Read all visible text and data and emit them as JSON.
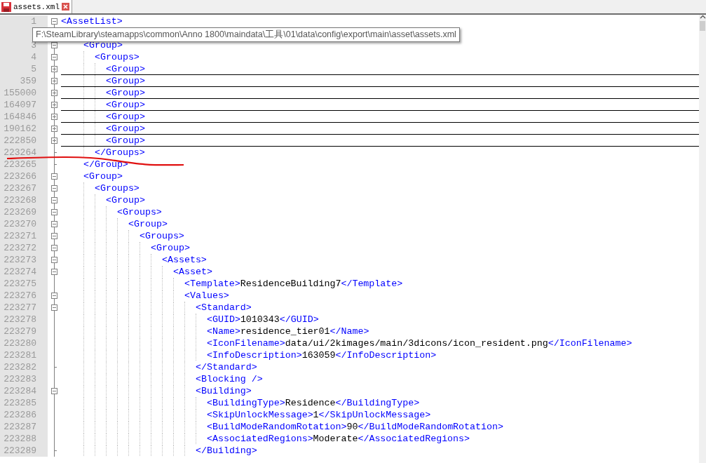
{
  "tab": {
    "title": "assets.xml",
    "selected": true
  },
  "tooltip": "F:\\SteamLibrary\\steamapps\\common\\Anno 1800\\maindata\\工具\\01\\data\\config\\export\\main\\asset\\assets.xml",
  "lines": [
    {
      "line": "1",
      "open": "<AssetList>",
      "expanded": true,
      "children": [
        {
          "expanded": true,
          "children": [
            {
              "line": "3",
              "open": "<Group>",
              "expanded": true,
              "end_line": "223265",
              "end_tag": "</Group>",
              "children": [
                {
                  "line": "4",
                  "open": "<Groups>",
                  "expanded": true,
                  "end_line": "223264",
                  "end_tag": "</Groups>",
                  "children": [
                    {
                      "line": "5",
                      "open": "<Group>",
                      "expanded": false
                    },
                    {
                      "line": "359",
                      "open": "<Group>",
                      "expanded": false
                    },
                    {
                      "line": "155000",
                      "open": "<Group>",
                      "expanded": false
                    },
                    {
                      "line": "164097",
                      "open": "<Group>",
                      "expanded": false
                    },
                    {
                      "line": "164846",
                      "open": "<Group>",
                      "expanded": false
                    },
                    {
                      "line": "190162",
                      "open": "<Group>",
                      "expanded": false
                    },
                    {
                      "line": "222850",
                      "open": "<Group>",
                      "expanded": false
                    }
                  ]
                }
              ]
            },
            {
              "line": "223266",
              "open": "<Group>",
              "expanded": true,
              "children": [
                {
                  "line": "223267",
                  "open": "<Groups>",
                  "expanded": true,
                  "children": [
                    {
                      "line": "223268",
                      "open": "<Group>",
                      "expanded": true,
                      "children": [
                        {
                          "line": "223269",
                          "open": "<Groups>",
                          "expanded": true,
                          "children": [
                            {
                              "line": "223270",
                              "open": "<Group>",
                              "expanded": true,
                              "children": [
                                {
                                  "line": "223271",
                                  "open": "<Groups>",
                                  "expanded": true,
                                  "children": [
                                    {
                                      "line": "223272",
                                      "open": "<Group>",
                                      "expanded": true,
                                      "children": [
                                        {
                                          "line": "223273",
                                          "open": "<Assets>",
                                          "expanded": true,
                                          "children": [
                                            {
                                              "line": "223274",
                                              "open": "<Asset>",
                                              "expanded": true,
                                              "children": [
                                                {
                                                  "line": "223275",
                                                  "open": "<Template>",
                                                  "value": "ResidenceBuilding7",
                                                  "close": "</Template>"
                                                },
                                                {
                                                  "line": "223276",
                                                  "open": "<Values>",
                                                  "expanded": true,
                                                  "children": [
                                                    {
                                                      "line": "223277",
                                                      "open": "<Standard>",
                                                      "expanded": true,
                                                      "end_line": "223282",
                                                      "end_tag": "</Standard>",
                                                      "children": [
                                                        {
                                                          "line": "223278",
                                                          "open": "<GUID>",
                                                          "value": "1010343",
                                                          "close": "</GUID>"
                                                        },
                                                        {
                                                          "line": "223279",
                                                          "open": "<Name>",
                                                          "value": "residence_tier01",
                                                          "close": "</Name>"
                                                        },
                                                        {
                                                          "line": "223280",
                                                          "open": "<IconFilename>",
                                                          "value": "data/ui/2kimages/main/3dicons/icon_resident.png",
                                                          "close": "</IconFilename>"
                                                        },
                                                        {
                                                          "line": "223281",
                                                          "open": "<InfoDescription>",
                                                          "value": "163059",
                                                          "close": "</InfoDescription>"
                                                        }
                                                      ]
                                                    },
                                                    {
                                                      "line": "223283",
                                                      "open": "<Blocking />"
                                                    },
                                                    {
                                                      "line": "223284",
                                                      "open": "<Building>",
                                                      "expanded": true,
                                                      "end_line": "223289",
                                                      "end_tag": "</Building>",
                                                      "children": [
                                                        {
                                                          "line": "223285",
                                                          "open": "<BuildingType>",
                                                          "value": "Residence",
                                                          "close": "</BuildingType>"
                                                        },
                                                        {
                                                          "line": "223286",
                                                          "open": "<SkipUnlockMessage>",
                                                          "value": "1",
                                                          "close": "</SkipUnlockMessage>"
                                                        },
                                                        {
                                                          "line": "223287",
                                                          "open": "<BuildModeRandomRotation>",
                                                          "value": "90",
                                                          "close": "</BuildModeRandomRotation>"
                                                        },
                                                        {
                                                          "line": "223288",
                                                          "open": "<AssociatedRegions>",
                                                          "value": "Moderate",
                                                          "close": "</AssociatedRegions>"
                                                        }
                                                      ]
                                                    }
                                                  ]
                                                }
                                              ]
                                            }
                                          ]
                                        }
                                      ]
                                    }
                                  ]
                                }
                              ]
                            }
                          ]
                        }
                      ]
                    }
                  ]
                }
              ]
            }
          ]
        }
      ]
    }
  ]
}
